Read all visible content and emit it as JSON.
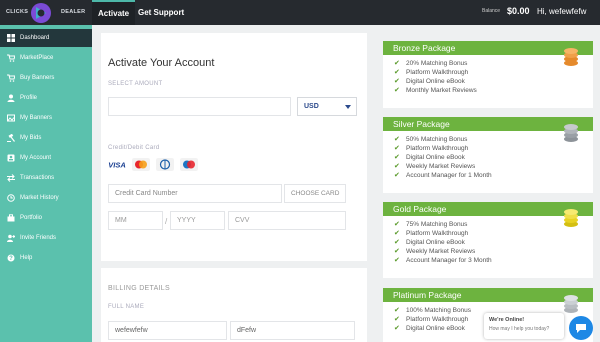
{
  "header": {
    "logo_left": "CLICKS",
    "logo_right": "DEALER",
    "nav": [
      "Activate",
      "Get Support"
    ],
    "balance_label": "Balance",
    "balance_value": "$0.00",
    "greeting": "Hi, wefewfefw"
  },
  "sidebar": {
    "items": [
      {
        "label": "Dashboard",
        "icon": "dashboard-icon"
      },
      {
        "label": "MarketPlace",
        "icon": "cart-icon"
      },
      {
        "label": "Buy Banners",
        "icon": "cart-icon"
      },
      {
        "label": "Profile",
        "icon": "user-icon"
      },
      {
        "label": "My Banners",
        "icon": "image-icon"
      },
      {
        "label": "My Bids",
        "icon": "gavel-icon"
      },
      {
        "label": "My Account",
        "icon": "account-icon"
      },
      {
        "label": "Transactions",
        "icon": "transactions-icon"
      },
      {
        "label": "Market History",
        "icon": "history-icon"
      },
      {
        "label": "Portfolio",
        "icon": "portfolio-icon"
      },
      {
        "label": "Invite Friends",
        "icon": "invite-icon"
      },
      {
        "label": "Help",
        "icon": "help-icon"
      }
    ]
  },
  "activate": {
    "title": "Activate Your Account",
    "amount_label": "SELECT AMOUNT",
    "amount_value": "",
    "currency": "USD",
    "card_label": "Credit/Debit Card",
    "card_brands": [
      "VISA",
      "Mastercard",
      "Diners Club",
      "Maestro"
    ],
    "card_number_placeholder": "Credit Card Number",
    "choose_card": "CHOOSE CARD",
    "mm_placeholder": "MM",
    "yyyy_placeholder": "YYYY",
    "cvv_placeholder": "CVV"
  },
  "billing": {
    "title": "BILLING DETAILS",
    "full_name_label": "FULL NAME",
    "first_name": "wefewfefw",
    "last_name": "dFefw"
  },
  "packages": [
    {
      "name": "Bronze Package",
      "coin_color": "#e58a2c",
      "features": [
        "20% Matching Bonus",
        "Platform Walkthrough",
        "Digital Online eBook",
        "Monthly Market Reviews"
      ]
    },
    {
      "name": "Silver Package",
      "coin_color": "#9aa0a6",
      "features": [
        "50% Matching Bonus",
        "Platform Walkthrough",
        "Digital Online eBook",
        "Weekly Market Reviews",
        "Account Manager for 1 Month"
      ]
    },
    {
      "name": "Gold Package",
      "coin_color": "#e8d222",
      "features": [
        "75% Matching Bonus",
        "Platform Walkthrough",
        "Digital Online eBook",
        "Weekly Market Reviews",
        "Account Manager for 3 Month"
      ]
    },
    {
      "name": "Platinum Package",
      "coin_color": "#b9bec3",
      "features": [
        "100% Matching Bonus",
        "Platform Walkthrough",
        "Digital Online eBook"
      ]
    }
  ],
  "chat": {
    "title": "We're Online!",
    "subtitle": "How may I help you today?"
  },
  "colors": {
    "accent": "#5bc1ad",
    "topbar": "#262a2f",
    "package_header": "#6db33f"
  }
}
